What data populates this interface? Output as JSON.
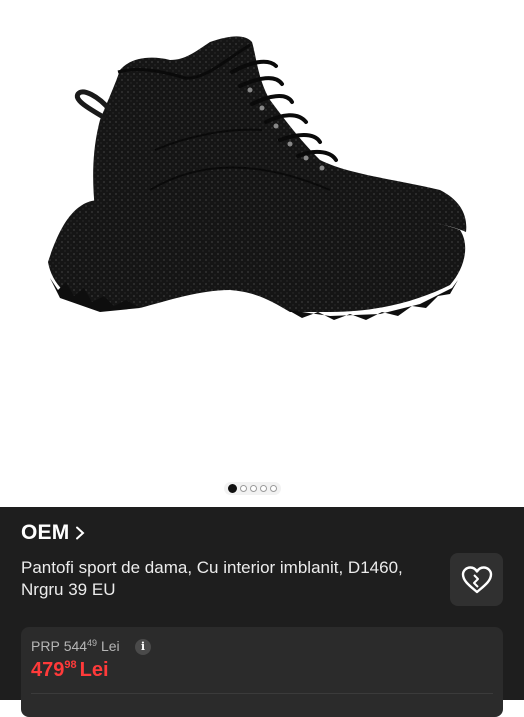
{
  "gallery": {
    "image_alt": "black rhinestone platform high-top sneaker",
    "page_count": 5,
    "active_index": 0
  },
  "product": {
    "brand": "OEM",
    "title": "Pantofi sport de dama, Cu interior imblanit, D1460, Nrgru 39 EU"
  },
  "pricing": {
    "prp_label": "PRP",
    "prp_int": "544",
    "prp_dec": "49",
    "prp_currency": "Lei",
    "price_int": "479",
    "price_dec": "98",
    "price_currency": "Lei",
    "info_glyph": "i"
  },
  "icons": {
    "brand_chevron": "chevron-right-icon",
    "favorite": "heart-outline-icon",
    "info": "info-icon"
  },
  "colors": {
    "panel_bg": "#1e1e1e",
    "card_bg": "#2b2b2b",
    "price_red": "#ff3a3a"
  }
}
